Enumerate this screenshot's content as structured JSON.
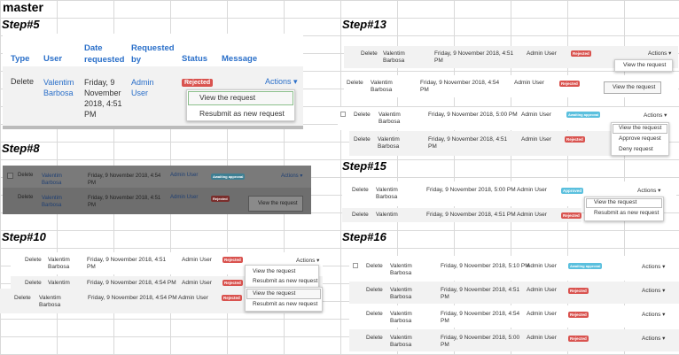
{
  "title": "master",
  "labels": {
    "step5": "Step#5",
    "step8": "Step#8",
    "step10": "Step#10",
    "step13": "Step#13",
    "step15": "Step#15",
    "step16": "Step#16"
  },
  "header": {
    "type": "Type",
    "user": "User",
    "date": "Date requested",
    "requested_by": "Requested by",
    "status": "Status",
    "message": "Message"
  },
  "common": {
    "delete": "Delete",
    "user": "Valentim Barbosa",
    "user1": "Valentim",
    "user2": "Barbosa",
    "admin": "Admin User",
    "actions": "Actions ▾"
  },
  "dates": {
    "d451": "Friday, 9 November 2018, 4:51 PM",
    "d454": "Friday, 9 November 2018, 4:54 PM",
    "d500": "Friday, 9 November 2018, 5:00 PM",
    "d510": "Friday, 9 November 2018, 5:10 PM"
  },
  "status": {
    "rejected": "Rejected",
    "awaiting": "Awaiting approval",
    "approved": "Approved"
  },
  "menu": {
    "view": "View the request",
    "resubmit": "Resubmit as new request",
    "approve": "Approve request",
    "deny": "Deny request"
  },
  "colors": {
    "link": "#2a6fc9",
    "rejected": "#d9534f",
    "awaiting": "#5bc0de"
  }
}
